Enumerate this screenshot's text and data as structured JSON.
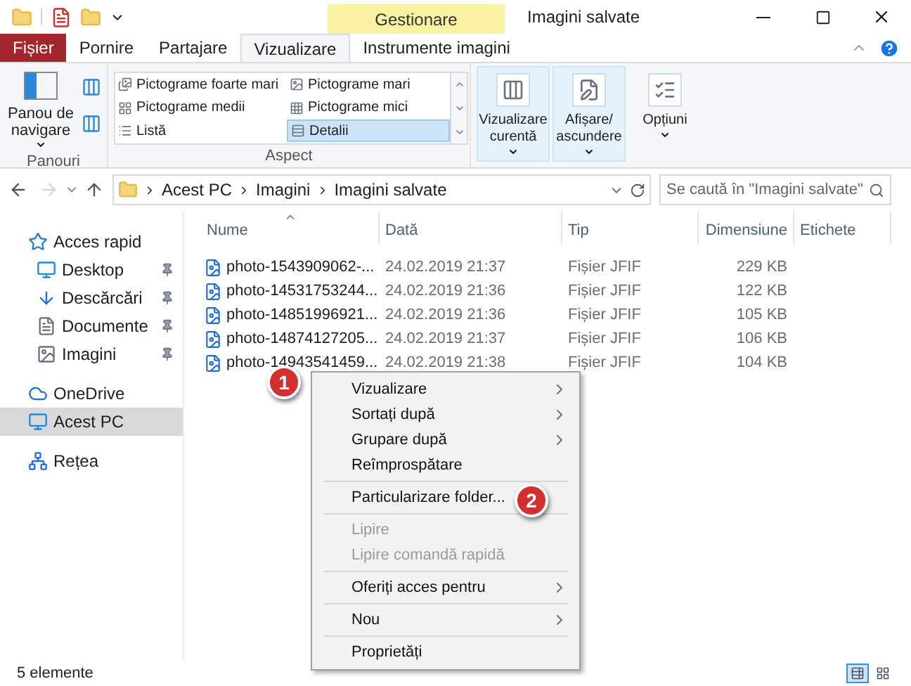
{
  "contextual_group": {
    "label": "Gestionare"
  },
  "window": {
    "title": "Imagini salvate"
  },
  "ribbon_tabs": [
    {
      "label": "Fișier",
      "kind": "file",
      "selected": false
    },
    {
      "label": "Pornire",
      "kind": "tab",
      "selected": false
    },
    {
      "label": "Partajare",
      "kind": "tab",
      "selected": false
    },
    {
      "label": "Vizualizare",
      "kind": "tab",
      "selected": true
    },
    {
      "label": "Instrumente imagini",
      "kind": "tab",
      "selected": false
    }
  ],
  "panes_group": {
    "button": "Panou de navigare",
    "label": "Panouri"
  },
  "layout_group": {
    "label": "Aspect",
    "options": [
      {
        "label": "Pictograme foarte mari",
        "kind": "xl",
        "selected": false
      },
      {
        "label": "Pictograme mari",
        "kind": "large",
        "selected": false
      },
      {
        "label": "Pictograme medii",
        "kind": "medium",
        "selected": false
      },
      {
        "label": "Pictograme mici",
        "kind": "small",
        "selected": false
      },
      {
        "label": "Listă",
        "kind": "list",
        "selected": false
      },
      {
        "label": "Detalii",
        "kind": "details",
        "selected": true
      }
    ]
  },
  "view_buttons": [
    {
      "label": "Vizualizare curentă",
      "kind": "current",
      "highlighted": true
    },
    {
      "label": "Afișare/ascundere",
      "kind": "showhide",
      "highlighted": true
    },
    {
      "label": "Opțiuni",
      "kind": "options",
      "highlighted": false
    }
  ],
  "address_bar": {
    "path": [
      "Acest PC",
      "Imagini",
      "Imagini salvate"
    ]
  },
  "search": {
    "placeholder": "Se caută în \"Imagini salvate\""
  },
  "navigation": [
    {
      "label": "Acces rapid",
      "kind": "star",
      "pinned": false,
      "selected": false
    },
    {
      "label": "Desktop",
      "kind": "desktop",
      "pinned": true,
      "selected": false
    },
    {
      "label": "Descărcări",
      "kind": "download",
      "pinned": true,
      "selected": false
    },
    {
      "label": "Documente",
      "kind": "document",
      "pinned": true,
      "selected": false
    },
    {
      "label": "Imagini",
      "kind": "pictures",
      "pinned": true,
      "selected": false
    },
    {
      "label": "OneDrive",
      "kind": "cloud",
      "pinned": false,
      "selected": false
    },
    {
      "label": "Acest PC",
      "kind": "pc",
      "pinned": false,
      "selected": true
    },
    {
      "label": "Rețea",
      "kind": "network",
      "pinned": false,
      "selected": false
    }
  ],
  "table": {
    "columns": [
      "Nume",
      "Dată",
      "Tip",
      "Dimensiune",
      "Etichete"
    ],
    "rows": [
      {
        "name": "photo-1543909062-...",
        "date": "24.02.2019 21:37",
        "type": "Fișier JFIF",
        "size": "229 KB"
      },
      {
        "name": "photo-14531753244...",
        "date": "24.02.2019 21:36",
        "type": "Fișier JFIF",
        "size": "122 KB"
      },
      {
        "name": "photo-14851996921...",
        "date": "24.02.2019 21:36",
        "type": "Fișier JFIF",
        "size": "105 KB"
      },
      {
        "name": "photo-14874127205...",
        "date": "24.02.2019 21:37",
        "type": "Fișier JFIF",
        "size": "106 KB"
      },
      {
        "name": "photo-14943541459...",
        "date": "24.02.2019 21:38",
        "type": "Fișier JFIF",
        "size": "104 KB"
      }
    ]
  },
  "context_menu": {
    "groups": [
      {
        "items": [
          {
            "label": "Vizualizare",
            "submenu": true,
            "disabled": false
          },
          {
            "label": "Sortați după",
            "submenu": true,
            "disabled": false
          },
          {
            "label": "Grupare după",
            "submenu": true,
            "disabled": false
          },
          {
            "label": "Reîmprospătare",
            "submenu": false,
            "disabled": false
          }
        ]
      },
      {
        "items": [
          {
            "label": "Particularizare folder...",
            "submenu": false,
            "disabled": false
          }
        ]
      },
      {
        "items": [
          {
            "label": "Lipire",
            "submenu": false,
            "disabled": true
          },
          {
            "label": "Lipire comandă rapidă",
            "submenu": false,
            "disabled": true
          }
        ]
      },
      {
        "items": [
          {
            "label": "Oferiți acces pentru",
            "submenu": true,
            "disabled": false
          }
        ]
      },
      {
        "items": [
          {
            "label": "Nou",
            "submenu": true,
            "disabled": false
          }
        ]
      },
      {
        "items": [
          {
            "label": "Proprietăți",
            "submenu": false,
            "disabled": false
          }
        ]
      }
    ]
  },
  "callouts": [
    {
      "label": "1"
    },
    {
      "label": "2"
    }
  ],
  "status_bar": {
    "count": "5 elemente"
  },
  "view_toggles": [
    {
      "kind": "details",
      "selected": true
    },
    {
      "kind": "large",
      "selected": false
    }
  ]
}
